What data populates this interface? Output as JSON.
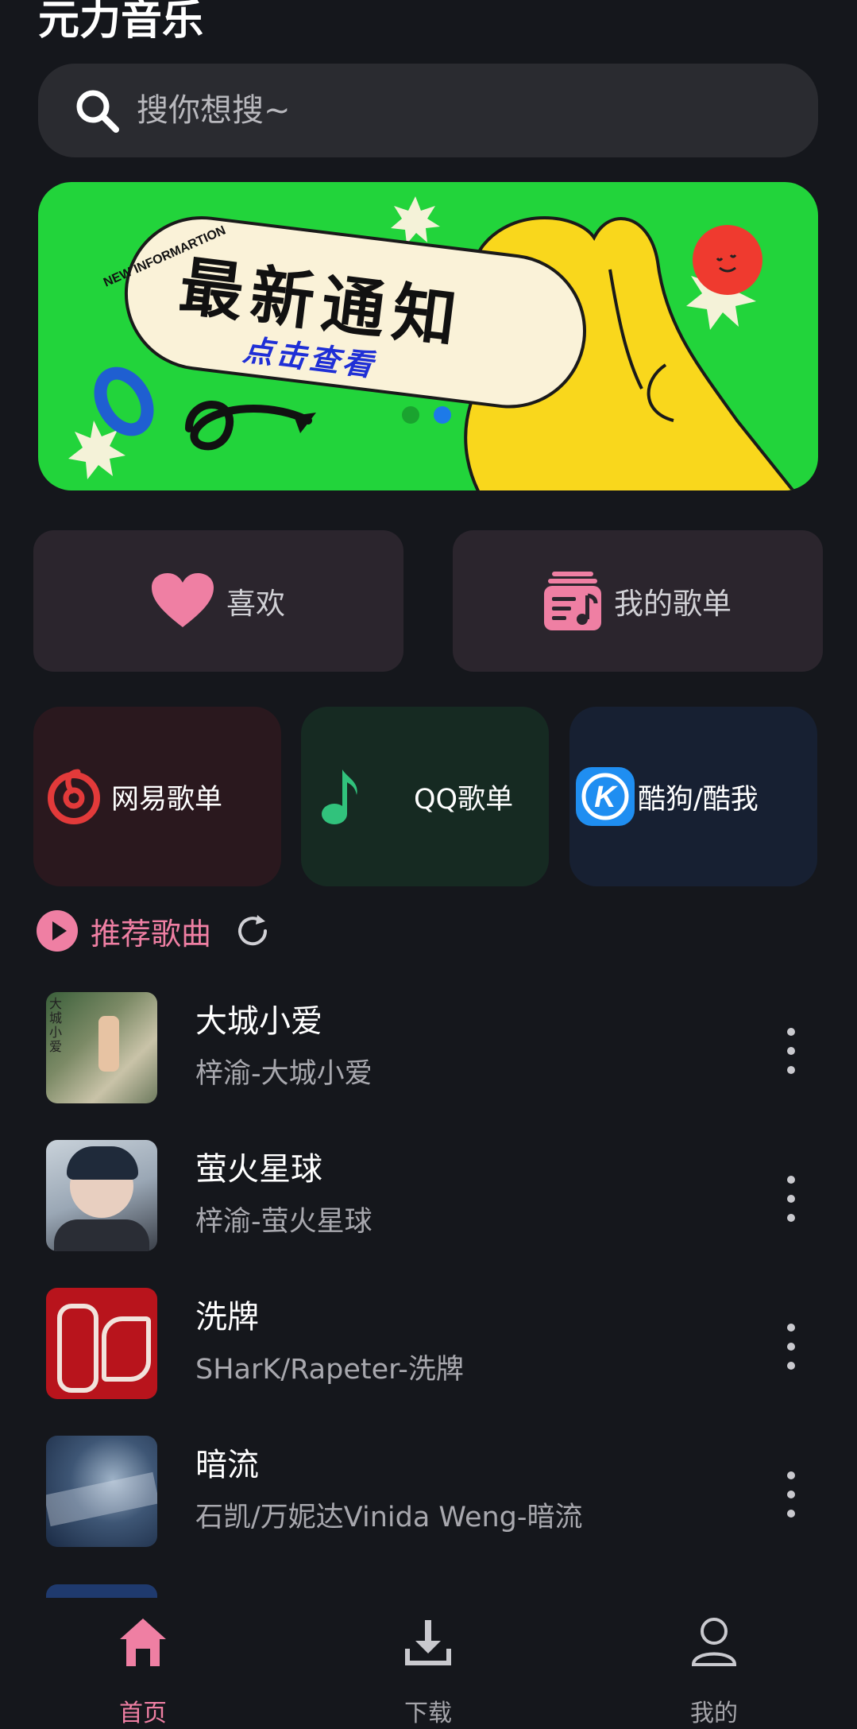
{
  "app": {
    "title": "元力音乐"
  },
  "search": {
    "placeholder": "搜你想搜~"
  },
  "banner": {
    "heading": "最新通知",
    "subheading": "点击查看",
    "tag": "NEW INFORMARTION",
    "dots_total": 2,
    "active_dot": 2
  },
  "quick_actions": [
    {
      "label": "喜欢",
      "icon": "heart-icon"
    },
    {
      "label": "我的歌单",
      "icon": "playlist-icon"
    }
  ],
  "sources": [
    {
      "label": "网易歌单",
      "icon": "netease-icon"
    },
    {
      "label": "QQ歌单",
      "icon": "qq-music-icon"
    },
    {
      "label": "酷狗/酷我",
      "icon": "kugou-icon"
    }
  ],
  "recommend": {
    "title": "推荐歌曲"
  },
  "songs": [
    {
      "title": "大城小爱",
      "subtitle": "梓渝-大城小爱",
      "cover_text": "大城小爱"
    },
    {
      "title": "萤火星球",
      "subtitle": "梓渝-萤火星球"
    },
    {
      "title": "洗牌",
      "subtitle": "SHarK/Rapeter-洗牌"
    },
    {
      "title": "暗流",
      "subtitle": "石凯/万妮达Vinida Weng-暗流"
    }
  ],
  "tabs": [
    {
      "label": "首页",
      "icon": "home-icon",
      "active": true
    },
    {
      "label": "下载",
      "icon": "download-icon",
      "active": false
    },
    {
      "label": "我的",
      "icon": "profile-icon",
      "active": false
    }
  ],
  "colors": {
    "background": "#15171c",
    "accent": "#ef7fa3",
    "banner_green": "#22d43b",
    "banner_yellow": "#f9d71c"
  }
}
